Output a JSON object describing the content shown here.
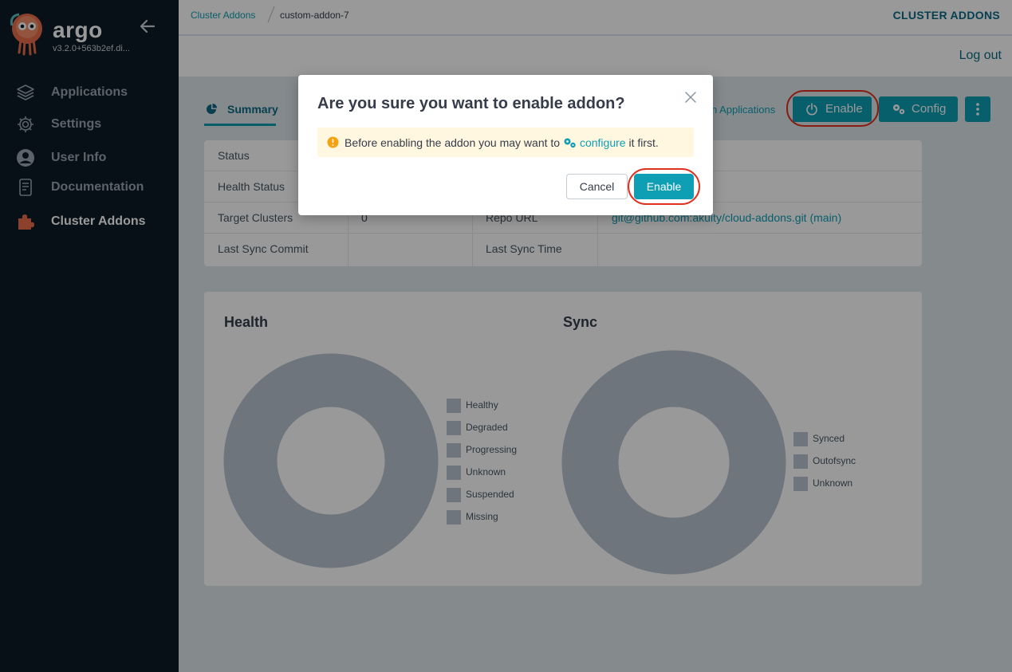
{
  "app": {
    "brand": "argo",
    "version": "v3.2.0+563b2ef.di..."
  },
  "sidebar": {
    "items": [
      {
        "label": "Applications",
        "icon": "layers-icon"
      },
      {
        "label": "Settings",
        "icon": "gear-icon"
      },
      {
        "label": "User Info",
        "icon": "user-icon"
      },
      {
        "label": "Documentation",
        "icon": "document-icon"
      },
      {
        "label": "Cluster Addons",
        "icon": "puzzle-icon",
        "active": true
      }
    ]
  },
  "header": {
    "breadcrumb_parent": "Cluster Addons",
    "breadcrumb_current": "custom-addon-7",
    "page_title": "CLUSTER ADDONS",
    "logout": "Log out"
  },
  "toolbar": {
    "tab_summary": "Summary",
    "tab_applications": "n Applications",
    "enable_label": "Enable",
    "config_label": "Config"
  },
  "info": {
    "rows": [
      {
        "label": "Status",
        "value": "",
        "label2": "",
        "value2": ""
      },
      {
        "label": "Health Status",
        "value": "",
        "label2": "",
        "value2": ""
      },
      {
        "label": "Target Clusters",
        "value": "0",
        "label2": "Repo URL",
        "value2": "git@github.com:akuity/cloud-addons.git (main)"
      },
      {
        "label": "Last Sync Commit",
        "value": "",
        "label2": "Last Sync Time",
        "value2": ""
      }
    ]
  },
  "charts": {
    "health": {
      "title": "Health",
      "legend": [
        "Healthy",
        "Degraded",
        "Progressing",
        "Unknown",
        "Suspended",
        "Missing"
      ]
    },
    "sync": {
      "title": "Sync",
      "legend": [
        "Synced",
        "Outofsync",
        "Unknown"
      ]
    }
  },
  "modal": {
    "title": "Are you sure you want to enable addon?",
    "alert_prefix": "Before enabling the addon you may want to",
    "alert_link": "configure",
    "alert_suffix": "it first.",
    "cancel_label": "Cancel",
    "enable_label": "Enable"
  },
  "colors": {
    "accent": "#0e9fb5",
    "sidebar_bg": "#0d1b26",
    "highlight_ring": "#e0301e",
    "alert_bg": "#fff7e0",
    "warning": "#f4a20f",
    "empty_chart": "#b9c3cf"
  }
}
